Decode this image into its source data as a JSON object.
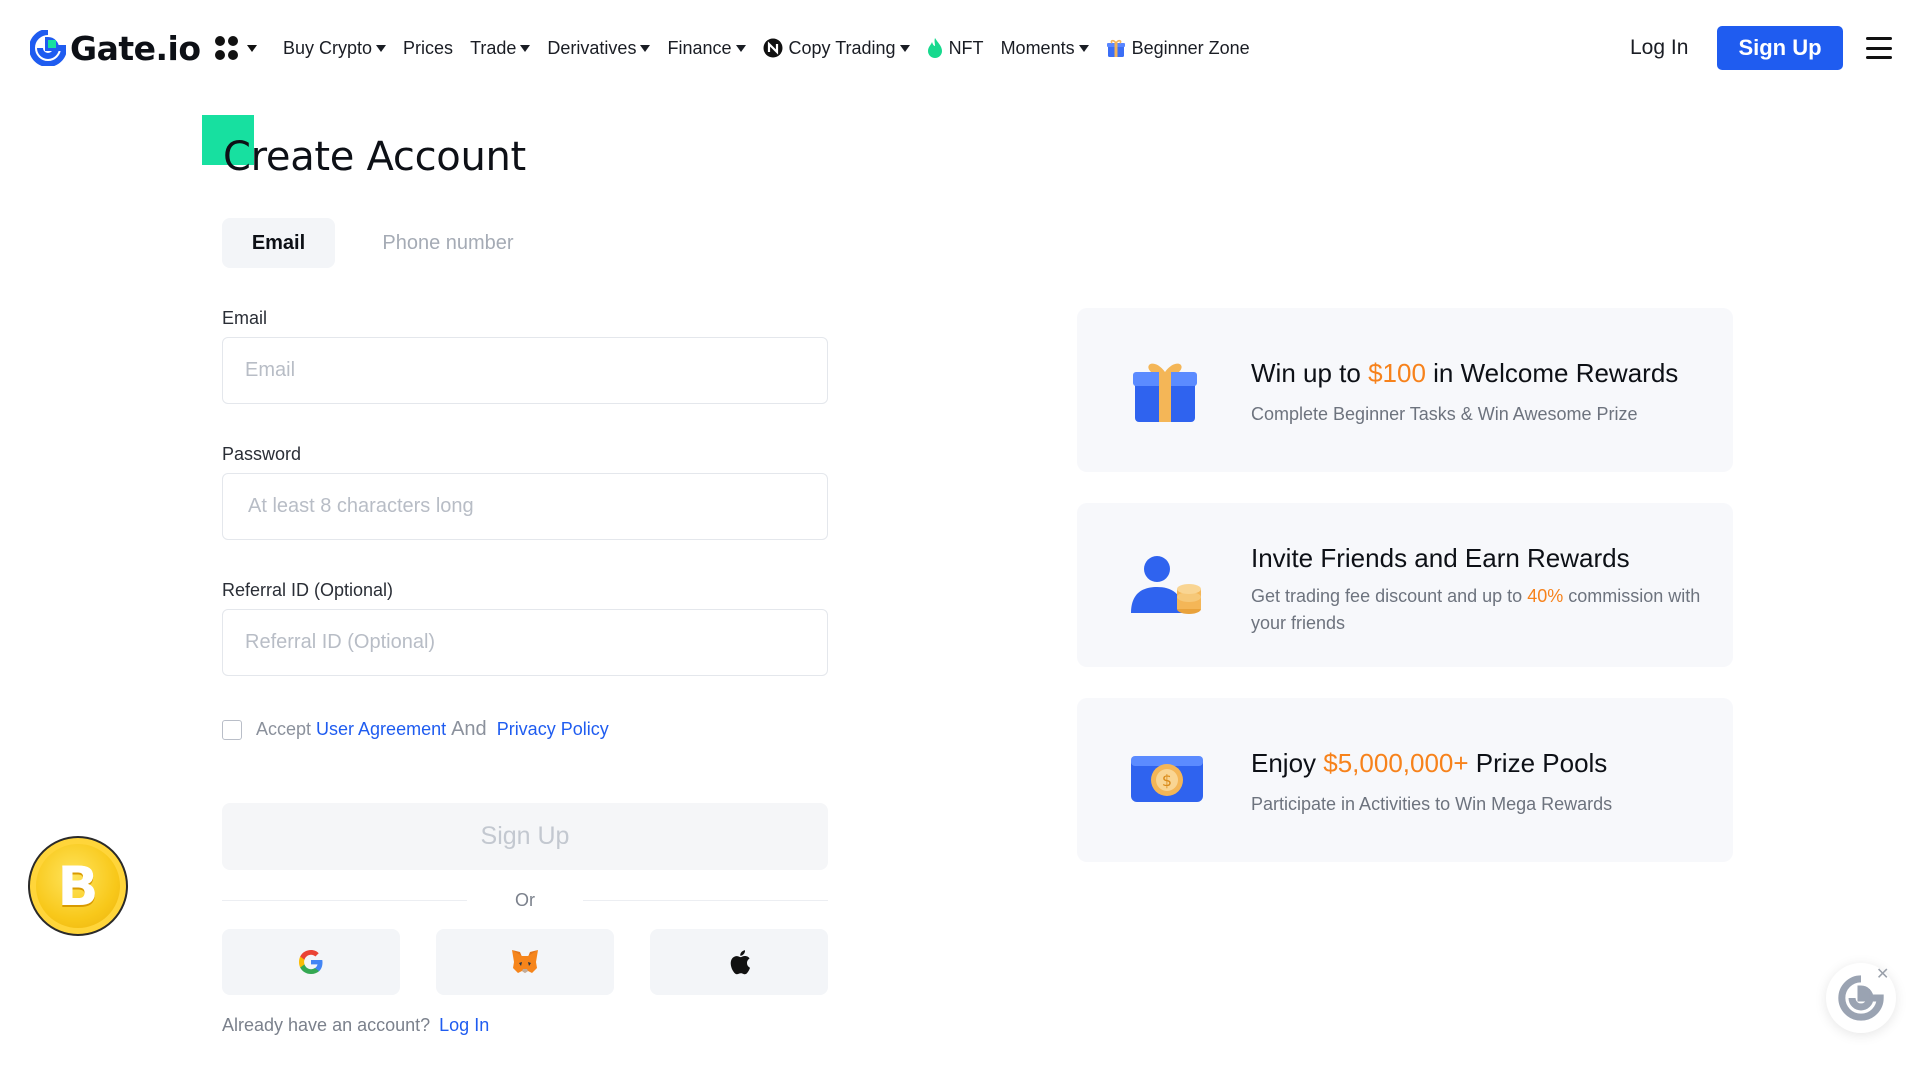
{
  "brand": {
    "name": "Gate.io",
    "accent": "#1f5cf0",
    "highlight": "#f7821b",
    "green": "#17e0a0"
  },
  "nav": {
    "items": [
      {
        "label": "Buy Crypto",
        "dropdown": true
      },
      {
        "label": "Prices",
        "dropdown": false
      },
      {
        "label": "Trade",
        "dropdown": true
      },
      {
        "label": "Derivatives",
        "dropdown": true
      },
      {
        "label": "Finance",
        "dropdown": true
      },
      {
        "label": "Copy Trading",
        "dropdown": true,
        "icon": "copy-trading-icon"
      },
      {
        "label": "NFT",
        "dropdown": false,
        "icon": "nft-flame-icon"
      },
      {
        "label": "Moments",
        "dropdown": true
      },
      {
        "label": "Beginner Zone",
        "dropdown": false,
        "icon": "gift-icon"
      }
    ],
    "login_label": "Log In",
    "signup_label": "Sign Up"
  },
  "form": {
    "title": "Create Account",
    "tabs": {
      "email": "Email",
      "phone": "Phone number"
    },
    "email": {
      "label": "Email",
      "placeholder": "Email"
    },
    "password": {
      "label": "Password",
      "placeholder": "At least 8 characters long"
    },
    "referral": {
      "label": "Referral ID (Optional)",
      "placeholder": "Referral ID (Optional)"
    },
    "agree": {
      "prefix": "Accept",
      "user_agreement": "User Agreement",
      "and": "And",
      "privacy_policy": "Privacy Policy"
    },
    "submit_label": "Sign Up",
    "or_label": "Or",
    "social": [
      "google-icon",
      "metamask-icon",
      "apple-icon"
    ],
    "already_text": "Already have an account?",
    "login_link": "Log In"
  },
  "cards": [
    {
      "title_pre": "Win up to ",
      "title_hl": "$100",
      "title_post": " in Welcome Rewards",
      "desc": "Complete Beginner Tasks & Win Awesome Prize",
      "icon": "gift-box-icon"
    },
    {
      "title": "Invite Friends and Earn Rewards",
      "desc_pre": "Get trading fee discount and up to ",
      "desc_hl": "40%",
      "desc_post": " commission with your friends",
      "icon": "invite-friends-icon"
    },
    {
      "title_pre": "Enjoy ",
      "title_hl": "$5,000,000+",
      "title_post": " Prize Pools",
      "desc": "Participate in Activities to Win Mega Rewards",
      "icon": "prize-wallet-icon"
    }
  ],
  "floaters": {
    "bitcoin_symbol": "B",
    "close_symbol": "✕"
  }
}
